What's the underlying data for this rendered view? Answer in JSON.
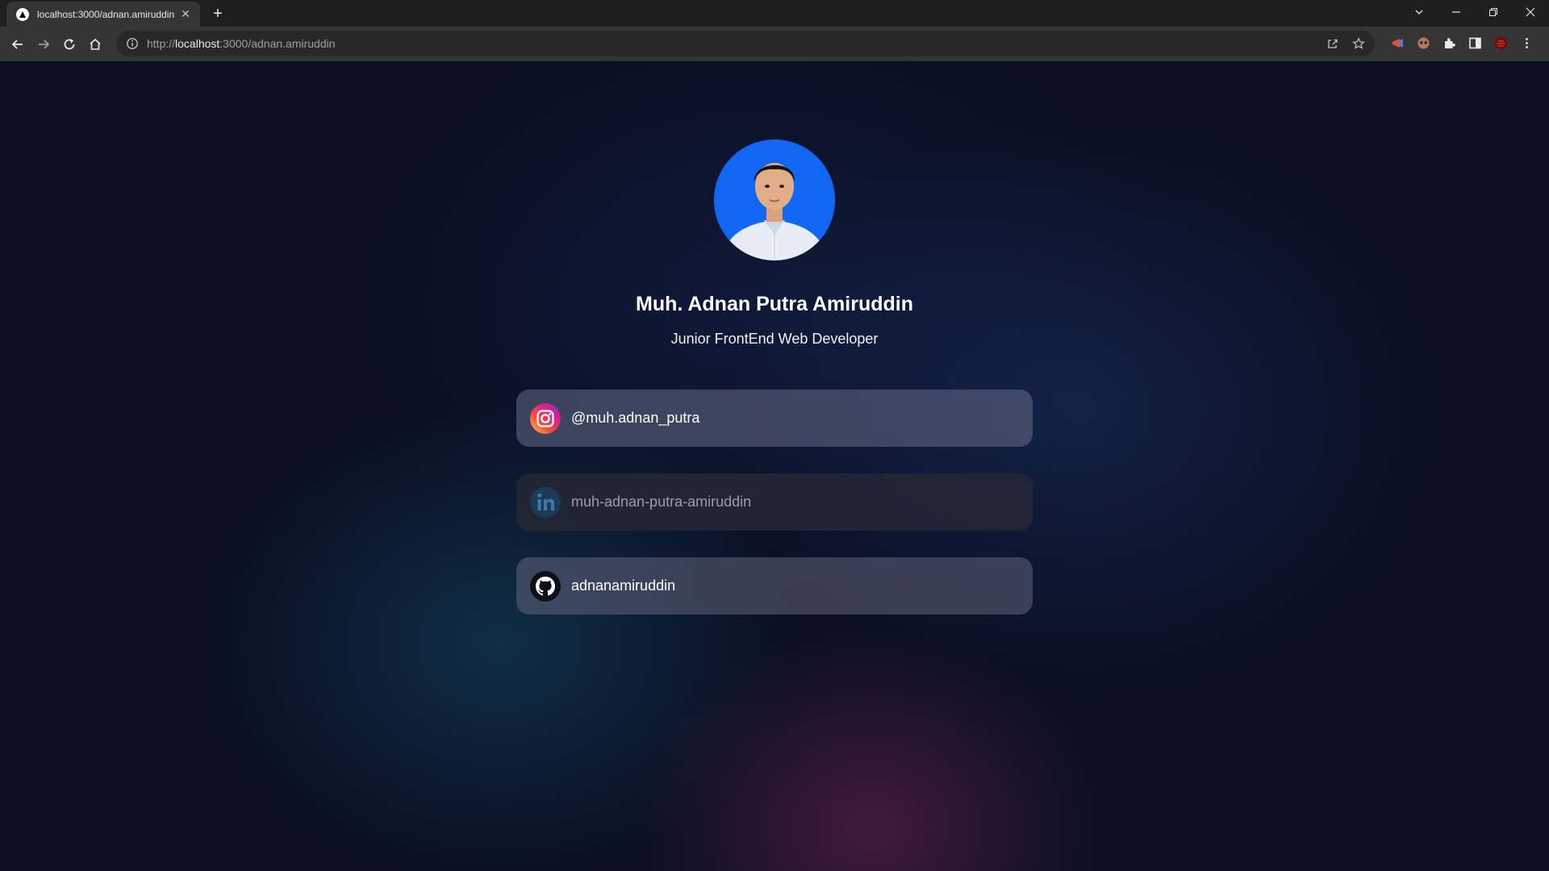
{
  "browser": {
    "tab_title": "localhost:3000/adnan.amiruddin",
    "url_scheme": "http://",
    "url_host": "localhost",
    "url_path": ":3000/adnan.amiruddin",
    "icons": [
      "back-icon",
      "forward-icon",
      "reload-icon",
      "home-icon",
      "info-icon",
      "share-icon",
      "star-icon",
      "extensions-icon",
      "sidepanel-icon",
      "menu-icon"
    ]
  },
  "profile": {
    "name": "Muh. Adnan Putra Amiruddin",
    "role": "Junior FrontEnd Web Developer"
  },
  "links": [
    {
      "platform": "instagram",
      "label": "@muh.adnan_putra",
      "icon": "instagram-icon"
    },
    {
      "platform": "linkedin",
      "label": "muh-adnan-putra-amiruddin",
      "icon": "linkedin-icon"
    },
    {
      "platform": "github",
      "label": "adnanamiruddin",
      "icon": "github-icon"
    }
  ],
  "colors": {
    "background": "#0a0f22",
    "avatar_bg": "#1167f2",
    "card_light": "#5e6380",
    "card_dark": "#23252f"
  }
}
